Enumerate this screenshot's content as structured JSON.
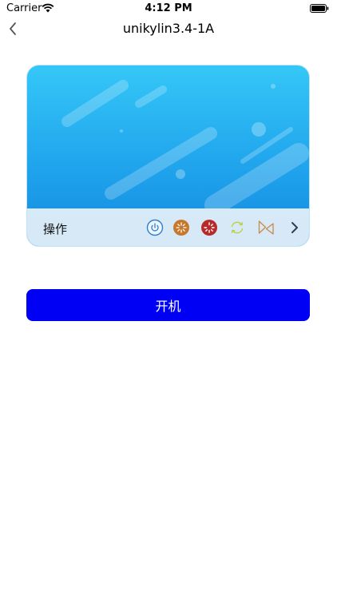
{
  "status_bar": {
    "carrier": "Carrier",
    "time": "4:12 PM",
    "icons": [
      "wifi-icon",
      "battery-icon"
    ]
  },
  "nav": {
    "title": "unikylin3.4-1A",
    "back_icon": "chevron-left-icon"
  },
  "device_card": {
    "operations_label": "操作",
    "operations": [
      {
        "name": "power-icon",
        "color": "#2f7fd0"
      },
      {
        "name": "restart-icon",
        "color": "#c7782a"
      },
      {
        "name": "shutdown-icon",
        "color": "#b82a2a"
      },
      {
        "name": "refresh-icon",
        "color": "#b9d24a"
      },
      {
        "name": "play-reverse-icon",
        "color": "#c98a4a"
      }
    ],
    "more_icon": "chevron-right-icon",
    "colors": {
      "gradient_top": "#35c7f7",
      "gradient_bottom": "#1289e0",
      "ops_bar": "#e2eef8"
    }
  },
  "actions": {
    "power_on_label": "开机",
    "power_on_color": "#0000f5"
  }
}
